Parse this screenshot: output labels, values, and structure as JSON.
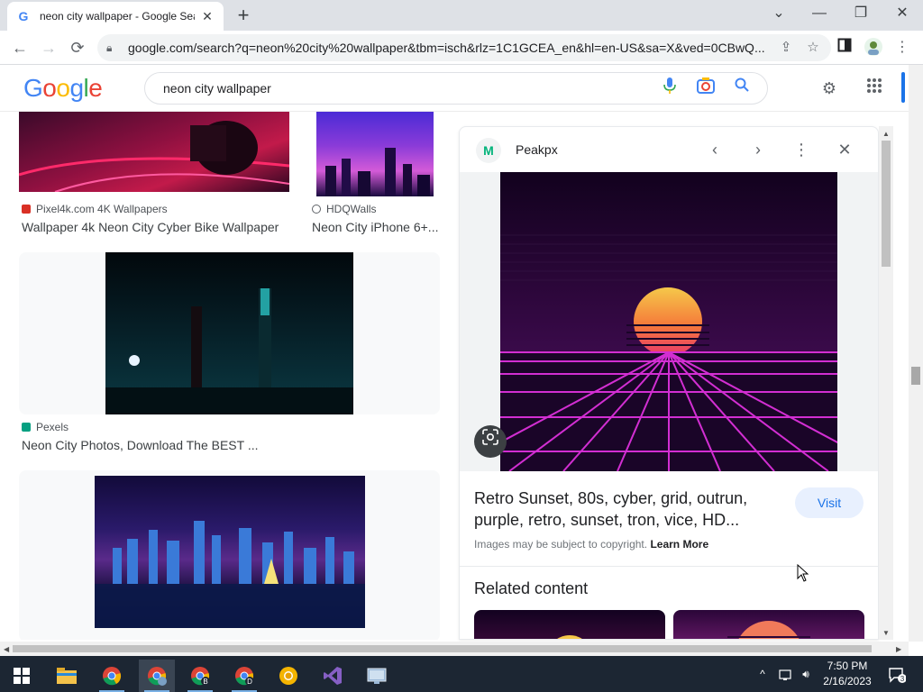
{
  "browser": {
    "tab_title": "neon city wallpaper - Google Sea",
    "favicon": "G",
    "url": "google.com/search?q=neon%20city%20wallpaper&tbm=isch&rlz=1C1GCEA_en&hl=en-US&sa=X&ved=0CBwQ..."
  },
  "google": {
    "logo_letters": [
      "G",
      "o",
      "o",
      "g",
      "l",
      "e"
    ],
    "logo_colors": [
      "#4285f4",
      "#ea4335",
      "#fbbc05",
      "#4285f4",
      "#34a853",
      "#ea4335"
    ],
    "query": "neon city wallpaper"
  },
  "results": [
    {
      "source": "Pixel4k.com 4K Wallpapers",
      "title": "Wallpaper 4k Neon City Cyber Bike Wallpaper"
    },
    {
      "source": "HDQWalls",
      "title": "Neon City iPhone 6+..."
    },
    {
      "source": "Pexels",
      "title": "Neon City Photos, Download The BEST ..."
    }
  ],
  "panel": {
    "source_name": "Peakpx",
    "source_logo": "M",
    "title": "Retro Sunset, 80s, cyber, grid, outrun, purple, retro, sunset, tron, vice, HD...",
    "visit_label": "Visit",
    "copyright_text": "Images may be subject to copyright.",
    "learn_more": "Learn More",
    "related_heading": "Related content"
  },
  "taskbar": {
    "time": "7:50 PM",
    "date": "2/16/2023",
    "notification_count": "3"
  },
  "colors": {
    "google_blue": "#1a73e8",
    "taskbar_bg": "#1c2633"
  }
}
